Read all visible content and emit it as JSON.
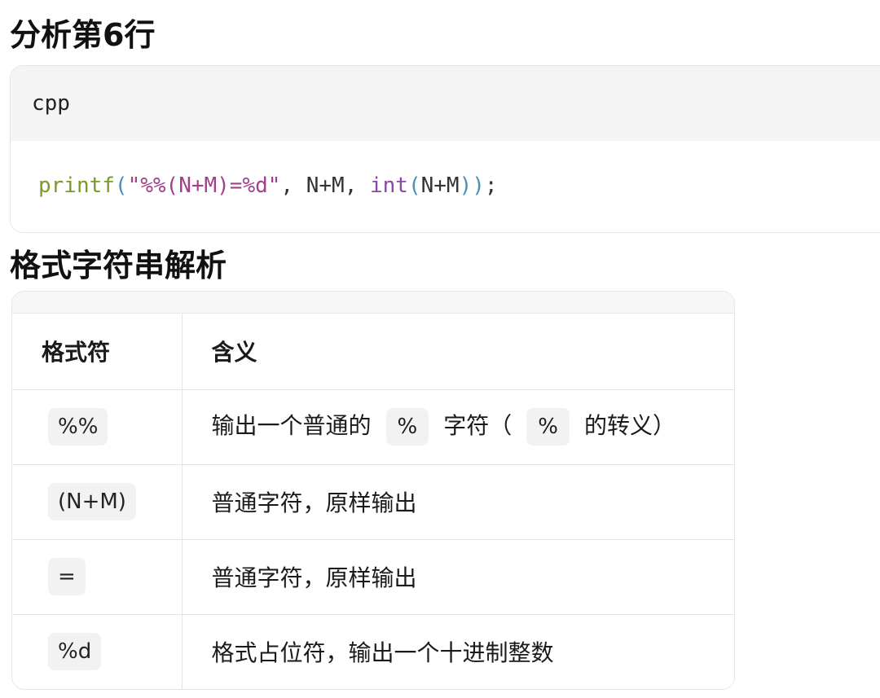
{
  "headings": {
    "analysis": "分析第6行",
    "format_parse": "格式字符串解析"
  },
  "code_block": {
    "language": "cpp",
    "tokens": {
      "func": "printf",
      "open_paren": "(",
      "string": "\"%%(N+M)=%d\"",
      "args1": ", N+M, ",
      "keyword": "int",
      "open_paren2": "(",
      "args2": "N+M",
      "close_parens": "))",
      "semicolon": ";"
    }
  },
  "table": {
    "headers": {
      "specifier": "格式符",
      "meaning": "含义"
    },
    "rows": [
      {
        "specifier": "%%",
        "meaning_parts": [
          "输出一个普通的",
          "%",
          "字符（",
          "%",
          "的转义）"
        ]
      },
      {
        "specifier": "(N+M)",
        "meaning": "普通字符，原样输出"
      },
      {
        "specifier": "=",
        "meaning": "普通字符，原样输出"
      },
      {
        "specifier": "%d",
        "meaning": "格式占位符，输出一个十进制整数"
      }
    ]
  },
  "colors": {
    "func": "#7a9a2a",
    "paren": "#4a8fb8",
    "string": "#a3408b",
    "keyword": "#8a46a8",
    "code_header_bg": "#f4f4f4"
  }
}
